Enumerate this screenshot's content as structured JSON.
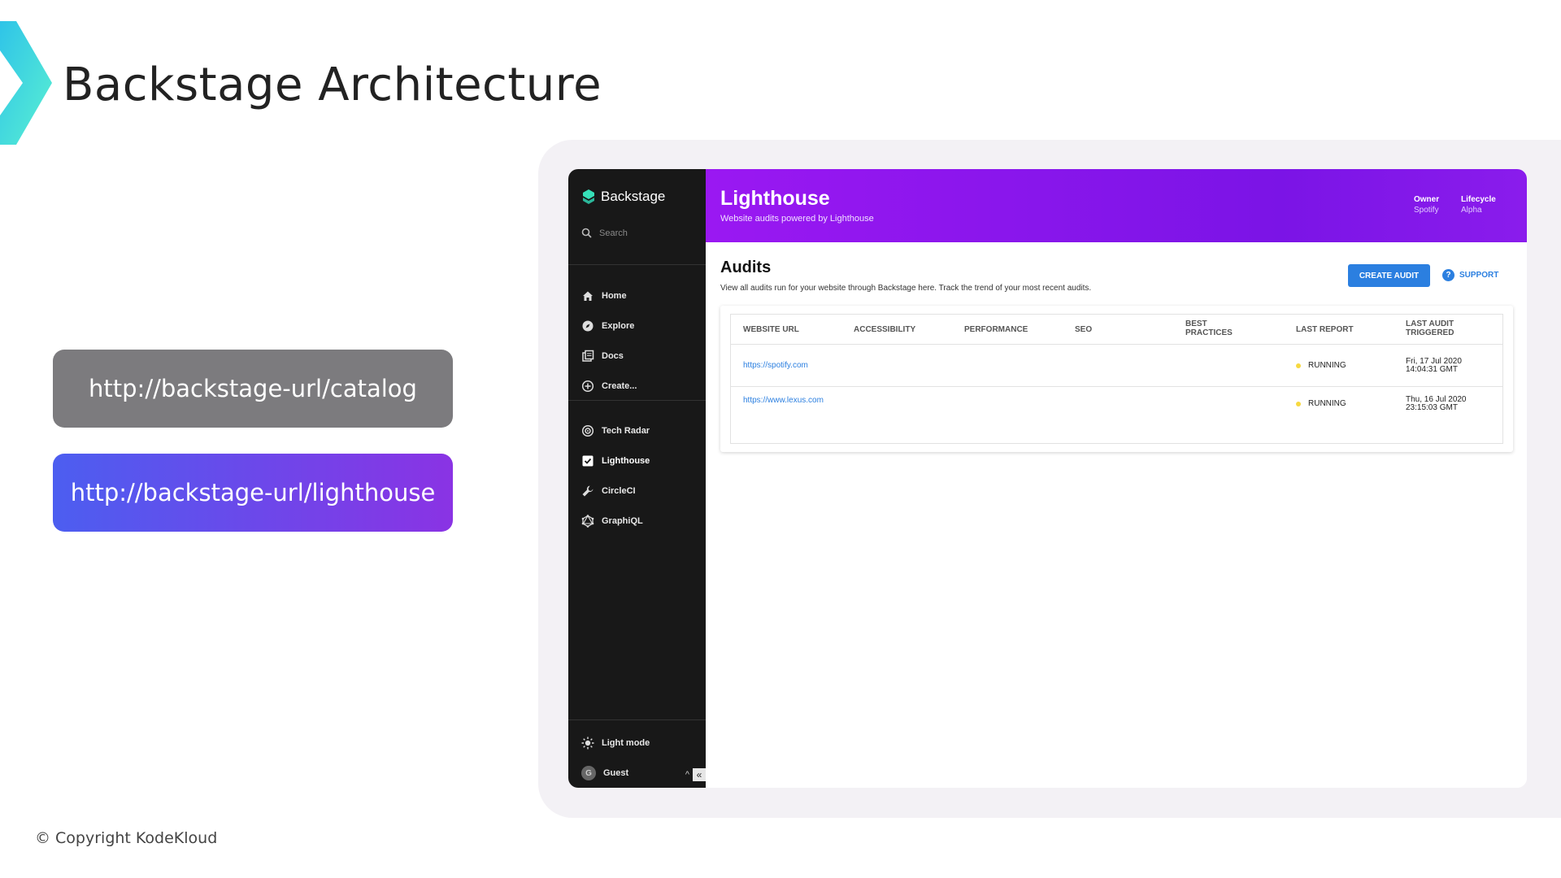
{
  "slide": {
    "title": "Backstage Architecture",
    "urls": [
      "http://backstage-url/catalog",
      "http://backstage-url/lighthouse"
    ],
    "copyright": "© Copyright KodeKloud",
    "colors": {
      "chevron": "#36d4e0",
      "pill_gray": "#7c7b7e",
      "pill_gradient_start": "#4c5ef0",
      "pill_gradient_end": "#8a33e4"
    }
  },
  "app": {
    "sidebar": {
      "logo": "Backstage",
      "search_placeholder": "Search",
      "items": [
        {
          "label": "Home",
          "icon": "home-icon"
        },
        {
          "label": "Explore",
          "icon": "compass-icon"
        },
        {
          "label": "Docs",
          "icon": "docs-icon"
        },
        {
          "label": "Create...",
          "icon": "plus-circle-icon"
        },
        {
          "label": "Tech Radar",
          "icon": "radar-icon"
        },
        {
          "label": "Lighthouse",
          "icon": "checkbox-icon",
          "active": true
        },
        {
          "label": "CircleCI",
          "icon": "wrench-icon"
        },
        {
          "label": "GraphiQL",
          "icon": "graphql-icon"
        }
      ],
      "light_mode": "Light mode",
      "guest": "Guest",
      "guest_initial": "G"
    },
    "header": {
      "title": "Lighthouse",
      "subtitle": "Website audits powered by Lighthouse",
      "owner_label": "Owner",
      "owner_value": "Spotify",
      "lifecycle_label": "Lifecycle",
      "lifecycle_value": "Alpha",
      "color": "#9a18f2"
    },
    "audits": {
      "title": "Audits",
      "description": "View all audits run for your website through Backstage here. Track the trend of your most recent audits.",
      "create_button": "CREATE AUDIT",
      "support_link": "SUPPORT",
      "columns": [
        "WEBSITE URL",
        "ACCESSIBILITY",
        "PERFORMANCE",
        "SEO",
        "BEST PRACTICES",
        "LAST REPORT",
        "LAST AUDIT TRIGGERED"
      ],
      "rows": [
        {
          "url": "https://spotify.com",
          "status": "RUNNING",
          "date_line1": "Fri, 17 Jul 2020",
          "date_line2": "14:04:31 GMT"
        },
        {
          "url": "https://www.lexus.com",
          "status": "RUNNING",
          "date_line1": "Thu, 16 Jul 2020",
          "date_line2": "23:15:03 GMT"
        }
      ]
    }
  }
}
